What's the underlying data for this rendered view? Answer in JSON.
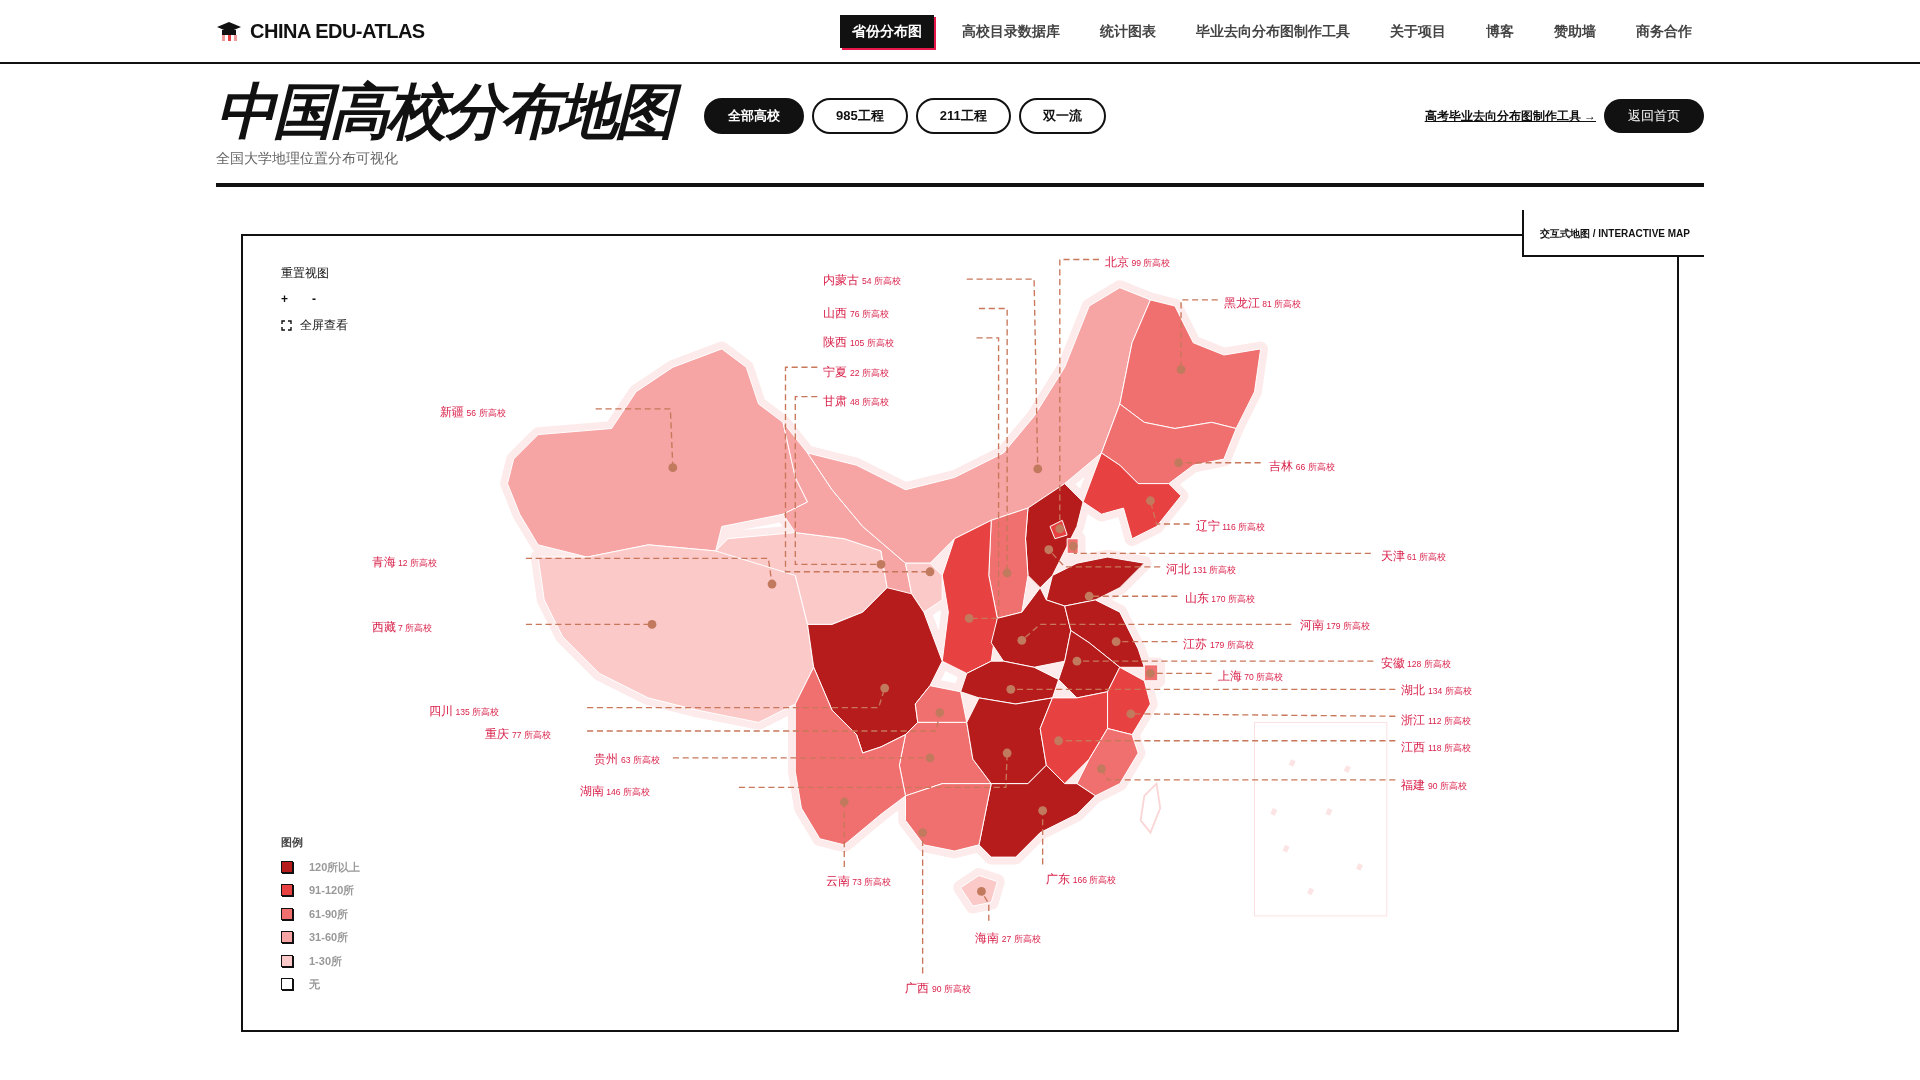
{
  "brand": {
    "name": "CHINA EDU-ATLAS"
  },
  "nav": [
    {
      "label": "省份分布图",
      "selected": true
    },
    {
      "label": "高校目录数据库",
      "selected": false
    },
    {
      "label": "统计图表",
      "selected": false
    },
    {
      "label": "毕业去向分布图制作工具",
      "selected": false
    },
    {
      "label": "关于项目",
      "selected": false
    },
    {
      "label": "博客",
      "selected": false
    },
    {
      "label": "赞助墙",
      "selected": false
    },
    {
      "label": "商务合作",
      "selected": false
    }
  ],
  "page": {
    "title": "中国高校分布地图",
    "subtitle": "全国大学地理位置分布可视化"
  },
  "filters": [
    {
      "label": "全部高校",
      "selected": true
    },
    {
      "label": "985工程",
      "selected": false
    },
    {
      "label": "211工程",
      "selected": false
    },
    {
      "label": "双一流",
      "selected": false
    }
  ],
  "tool_link": "高考毕业去向分布图制作工具 →",
  "home_button": "返回首页",
  "map_tag": "交互式地图 / INTERACTIVE MAP",
  "controls": {
    "reset": "重置视图",
    "zoom_in": "+",
    "zoom_out": "-",
    "fullscreen": "全屏查看"
  },
  "legend": {
    "title": "图例",
    "items": [
      {
        "label": "120所以上",
        "color": "#b71c1c"
      },
      {
        "label": "91-120所",
        "color": "#e84142"
      },
      {
        "label": "61-90所",
        "color": "#f07070"
      },
      {
        "label": "31-60所",
        "color": "#f7a4a4"
      },
      {
        "label": "1-30所",
        "color": "#fcc9c9"
      },
      {
        "label": "无",
        "color": "#ffffff"
      }
    ]
  },
  "provinces": [
    {
      "name": "北京",
      "count": "99 所高校",
      "color": "#e84142"
    },
    {
      "name": "内蒙古",
      "count": "54 所高校",
      "color": "#f7a4a4"
    },
    {
      "name": "山西",
      "count": "76 所高校",
      "color": "#f07070"
    },
    {
      "name": "黑龙江",
      "count": "81 所高校",
      "color": "#f07070"
    },
    {
      "name": "陕西",
      "count": "105 所高校",
      "color": "#e84142"
    },
    {
      "name": "宁夏",
      "count": "22 所高校",
      "color": "#fcc9c9"
    },
    {
      "name": "新疆",
      "count": "56 所高校",
      "color": "#f7a4a4"
    },
    {
      "name": "甘肃",
      "count": "48 所高校",
      "color": "#f7a4a4"
    },
    {
      "name": "吉林",
      "count": "66 所高校",
      "color": "#f07070"
    },
    {
      "name": "辽宁",
      "count": "116 所高校",
      "color": "#e84142"
    },
    {
      "name": "青海",
      "count": "12 所高校",
      "color": "#fcc9c9"
    },
    {
      "name": "河北",
      "count": "131 所高校",
      "color": "#b71c1c"
    },
    {
      "name": "天津",
      "count": "61 所高校",
      "color": "#f07070"
    },
    {
      "name": "山东",
      "count": "170 所高校",
      "color": "#b71c1c"
    },
    {
      "name": "西藏",
      "count": "7 所高校",
      "color": "#fcc9c9"
    },
    {
      "name": "河南",
      "count": "179 所高校",
      "color": "#b71c1c"
    },
    {
      "name": "江苏",
      "count": "179 所高校",
      "color": "#b71c1c"
    },
    {
      "name": "上海",
      "count": "70 所高校",
      "color": "#f07070"
    },
    {
      "name": "安徽",
      "count": "128 所高校",
      "color": "#b71c1c"
    },
    {
      "name": "湖北",
      "count": "134 所高校",
      "color": "#b71c1c"
    },
    {
      "name": "四川",
      "count": "135 所高校",
      "color": "#b71c1c"
    },
    {
      "name": "浙江",
      "count": "112 所高校",
      "color": "#e84142"
    },
    {
      "name": "重庆",
      "count": "77 所高校",
      "color": "#f07070"
    },
    {
      "name": "江西",
      "count": "118 所高校",
      "color": "#e84142"
    },
    {
      "name": "贵州",
      "count": "63 所高校",
      "color": "#f07070"
    },
    {
      "name": "湖南",
      "count": "146 所高校",
      "color": "#b71c1c"
    },
    {
      "name": "福建",
      "count": "90 所高校",
      "color": "#f07070"
    },
    {
      "name": "云南",
      "count": "73 所高校",
      "color": "#f07070"
    },
    {
      "name": "广东",
      "count": "166 所高校",
      "color": "#b71c1c"
    },
    {
      "name": "海南",
      "count": "27 所高校",
      "color": "#fcc9c9"
    },
    {
      "name": "广西",
      "count": "90 所高校",
      "color": "#f07070"
    }
  ]
}
